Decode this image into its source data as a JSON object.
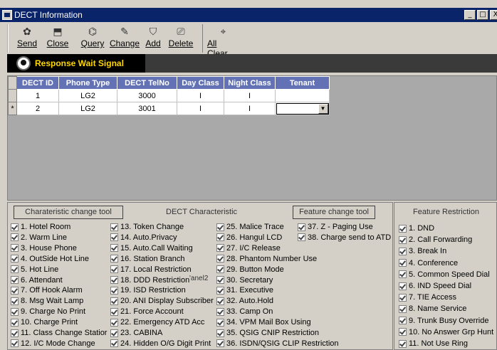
{
  "window": {
    "title": "DECT Information",
    "buttons": [
      "_",
      "□",
      "X"
    ]
  },
  "toolbar": [
    {
      "label": "Send",
      "icon": "send-icon",
      "glyph": "✿"
    },
    {
      "label": "Close",
      "icon": "close-icon",
      "glyph": "⬒"
    },
    {
      "label": "Query",
      "icon": "query-icon",
      "glyph": "⌬"
    },
    {
      "label": "Change",
      "icon": "change-icon",
      "glyph": "✎"
    },
    {
      "label": "Add",
      "icon": "add-icon",
      "glyph": "⛉"
    },
    {
      "label": "Delete",
      "icon": "delete-icon",
      "glyph": "⎚"
    },
    {
      "label": "All Clear",
      "icon": "all-clear-icon",
      "glyph": "⌖"
    }
  ],
  "status": {
    "text": "Response Wait Signal",
    "icon": "signal-icon"
  },
  "grid": {
    "columns": [
      "DECT ID",
      "Phone Type",
      "DECT TelNo",
      "Day Class",
      "Night Class",
      "Tenant"
    ],
    "rows": [
      {
        "marker": "",
        "cells": [
          "1",
          "LG2",
          "3000",
          "I",
          "I",
          ""
        ]
      },
      {
        "marker": "*",
        "cells": [
          "2",
          "LG2",
          "3001",
          "I",
          "I",
          ""
        ]
      }
    ]
  },
  "panel": {
    "char_tool": "Charateristic change tool",
    "dect_char": "DECT Characteristic",
    "feat_tool": "Feature change tool",
    "overlap": "'anel2",
    "col1": [
      "1. Hotel Room",
      "2. Warm Line",
      "3. House Phone",
      "4. OutSide Hot Line",
      "5. Hot Line",
      "6. Attendant",
      "7. Off Hook Alarm",
      "8. Msg Wait Lamp",
      "9. Charge No Print",
      "10. Charge Print",
      "11. Class Change Statior",
      "12. I/C Mode Change"
    ],
    "col2": [
      "13. Token Change",
      "14. Auto.Privacy",
      "15. Auto.Call Waiting",
      "16. Station Branch",
      "17. Local Restriction",
      "18. DDD Restriction",
      "19. ISD Restriction",
      "20. ANI Display Subscriber",
      "21. Force Account",
      "22. Emergency ATD Acc",
      "23. CABINA",
      "24. Hidden O/G Digit Print"
    ],
    "col3": [
      "25. Malice Trace",
      "26. Hangul LCD",
      "27. I/C Release",
      "28. Phantom Number Use",
      "29. Button Mode",
      "30. Secretary",
      "31. Executive",
      "32. Auto.Hold",
      "33. Camp On",
      "34. VPM Mail Box Using",
      "35. QSIG CNIP Restriction",
      "36. ISDN/QSIG CLIP Restriction"
    ],
    "col4": [
      "37. Z - Paging Use",
      "38. Charge send to ATD"
    ]
  },
  "restriction": {
    "title": "Feature Restriction",
    "items": [
      "1. DND",
      "2. Call Forwarding",
      "3. Break In",
      "4. Conference",
      "5. Common Speed Dial",
      "6. IND Speed Dial",
      "7. TIE Access",
      "8. Name Service",
      "9. Trunk Busy Override",
      "10. No Answer Grp Hunt",
      "11. Not Use Ring"
    ]
  }
}
